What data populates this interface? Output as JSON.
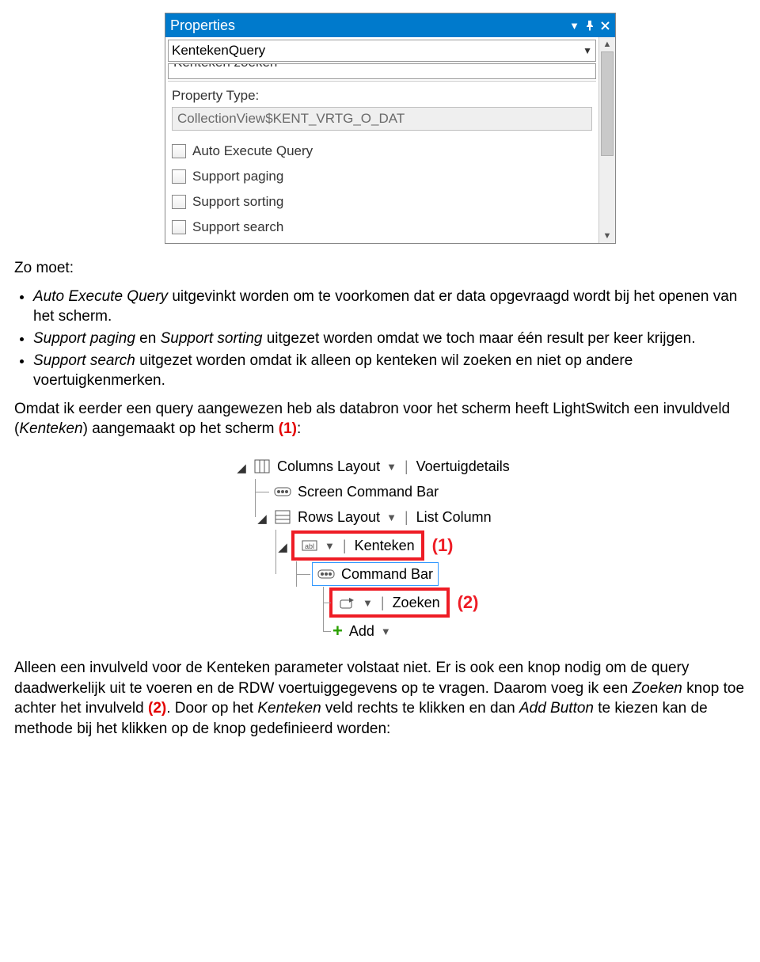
{
  "propsPanel": {
    "title": "Properties",
    "selected": "KentekenQuery",
    "truncated": "Kenteken zoeken",
    "propertyTypeLabel": "Property Type:",
    "propertyTypeValue": "CollectionView$KENT_VRTG_O_DAT",
    "checks": {
      "autoExec": "Auto Execute Query",
      "paging": "Support paging",
      "sorting": "Support sorting",
      "search": "Support search"
    }
  },
  "doc": {
    "intro": "Zo moet:",
    "b1a": "Auto Execute Query",
    "b1b": " uitgevinkt worden om te voorkomen dat er data opgevraagd wordt bij het openen van het scherm.",
    "b2a": "Support paging",
    "b2mid": " en ",
    "b2b": "Support sorting",
    "b2c": " uitgezet worden omdat we toch maar één result per keer krijgen.",
    "b3a": "Support search",
    "b3b": " uitgezet worden omdat ik alleen op kenteken wil zoeken en niet op andere voertuigkenmerken.",
    "p2a": "Omdat ik eerder een query aangewezen heb als databron voor het scherm heeft LightSwitch een invuldveld (",
    "p2em": "Kenteken",
    "p2b": ") aangemaakt op het scherm ",
    "p2mark": "(1)",
    "p2c": ":",
    "p3a": "Alleen een invulveld voor de Kenteken parameter volstaat niet. Er is ook een knop nodig om de query daadwerkelijk uit te voeren en de RDW voertuiggegevens op te vragen. Daarom voeg ik een ",
    "p3em1": "Zoeken",
    "p3b": " knop toe achter het invulveld ",
    "p3mark": "(2)",
    "p3c": ". Door op het ",
    "p3em2": "Kenteken",
    "p3d": " veld rechts te klikken en dan ",
    "p3em3": "Add Button",
    "p3e": " te kiezen kan de methode bij het klikken op de knop gedefinieerd worden:"
  },
  "tree": {
    "colLayout": "Columns Layout",
    "voertuig": "Voertuigdetails",
    "screenCmd": "Screen Command Bar",
    "rowsLayout": "Rows Layout",
    "listCol": "List Column",
    "kenteken": "Kenteken",
    "cmdBar": "Command Bar",
    "zoeken": "Zoeken",
    "add": "Add",
    "label1": "(1)",
    "label2": "(2)"
  }
}
